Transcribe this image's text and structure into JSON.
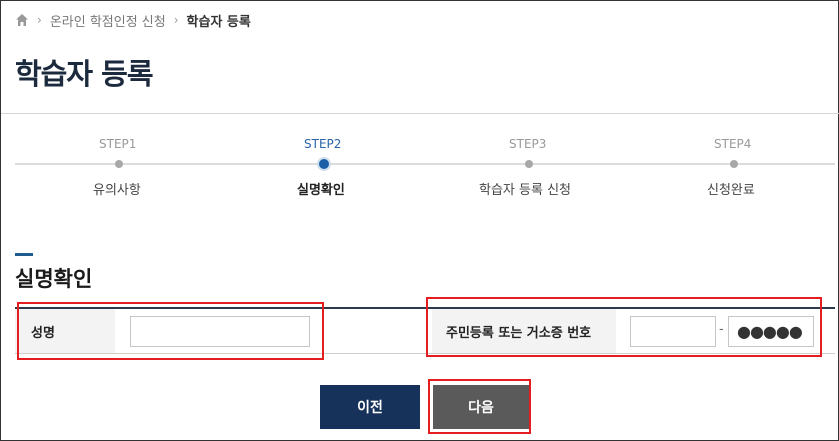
{
  "breadcrumb": {
    "home_icon": "home-icon",
    "items": [
      "온라인 학점인정 신청",
      "학습자 등록"
    ]
  },
  "page_title": "학습자 등록",
  "steps": [
    {
      "num": "STEP1",
      "label": "유의사항",
      "active": false
    },
    {
      "num": "STEP2",
      "label": "실명확인",
      "active": true
    },
    {
      "num": "STEP3",
      "label": "학습자 등록 신청",
      "active": false
    },
    {
      "num": "STEP4",
      "label": "신청완료",
      "active": false
    }
  ],
  "section_title": "실명확인",
  "form": {
    "name_label": "성명",
    "name_value": "",
    "rrn_label": "주민등록 또는 거소증 번호",
    "rrn_front_value": "",
    "rrn_separator": "-",
    "rrn_back_masked": "●●●●●"
  },
  "buttons": {
    "prev": "이전",
    "next": "다음"
  },
  "colors": {
    "title": "#1c2a3e",
    "accent": "#1a5fa5",
    "prev_button": "#17325a",
    "next_button": "#5a5a5a",
    "highlight": "#e41e1e"
  }
}
